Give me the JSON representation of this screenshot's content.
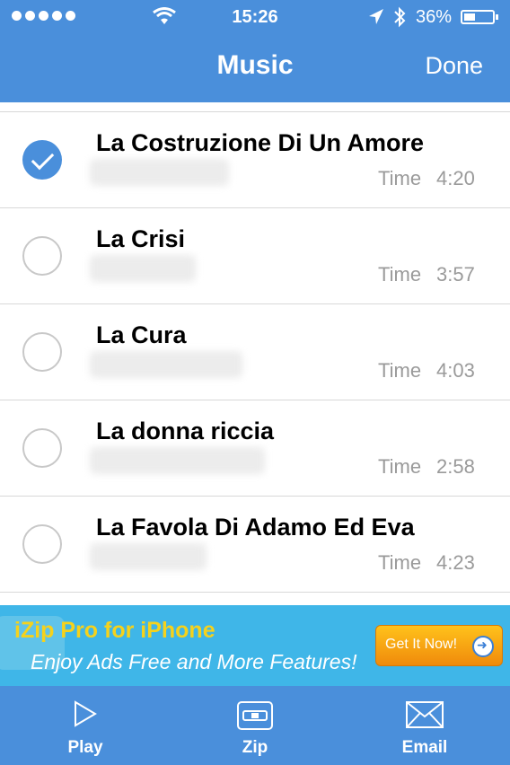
{
  "status_bar": {
    "time": "15:26",
    "battery": "36%"
  },
  "header": {
    "title": "Music",
    "done_label": "Done"
  },
  "songs": [
    {
      "title": "La Costruzione Di Un Amore",
      "time_label": "Time",
      "time": "4:20",
      "selected": true
    },
    {
      "title": "La Crisi",
      "time_label": "Time",
      "time": "3:57",
      "selected": false
    },
    {
      "title": "La Cura",
      "time_label": "Time",
      "time": "4:03",
      "selected": false
    },
    {
      "title": "La donna riccia",
      "time_label": "Time",
      "time": "2:58",
      "selected": false
    },
    {
      "title": "La Favola Di Adamo Ed Eva",
      "time_label": "Time",
      "time": "4:23",
      "selected": false
    }
  ],
  "ad": {
    "title": "iZip Pro for iPhone",
    "subtitle": "Enjoy Ads Free and More Features!",
    "button_label": "Get It Now!"
  },
  "tabbar": {
    "play_label": "Play",
    "zip_label": "Zip",
    "email_label": "Email"
  },
  "colors": {
    "accent": "#4a8fdb",
    "ad_background": "#3fb6e8",
    "ad_button": "#f5a412"
  }
}
